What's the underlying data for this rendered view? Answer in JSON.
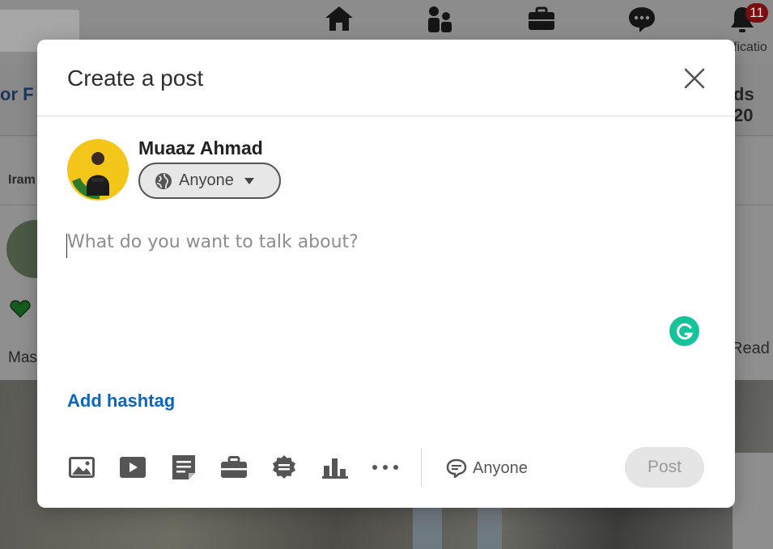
{
  "background": {
    "notification_count": "11",
    "notification_label": "ficatio",
    "banner_left_text": "or F",
    "banner_right_text": "ds 20",
    "feed_author_text": "Iram",
    "feed_snippet_text": "Mas",
    "read_more_text": "Read"
  },
  "modal": {
    "title": "Create a post",
    "author": {
      "name": "Muaaz Ahmad",
      "audience_label": "Anyone"
    },
    "editor": {
      "placeholder": "What do you want to talk about?",
      "value": ""
    },
    "hashtag_label": "Add hashtag",
    "comment_scope_label": "Anyone",
    "post_label": "Post"
  },
  "toolbar": {
    "icons": [
      "photo-icon",
      "video-icon",
      "document-icon",
      "job-icon",
      "celebrate-icon",
      "poll-icon",
      "more-icon"
    ]
  },
  "colors": {
    "accent": "#0a66c2",
    "grammarly": "#15c39a",
    "disabled_button": "#e5e5e5"
  }
}
